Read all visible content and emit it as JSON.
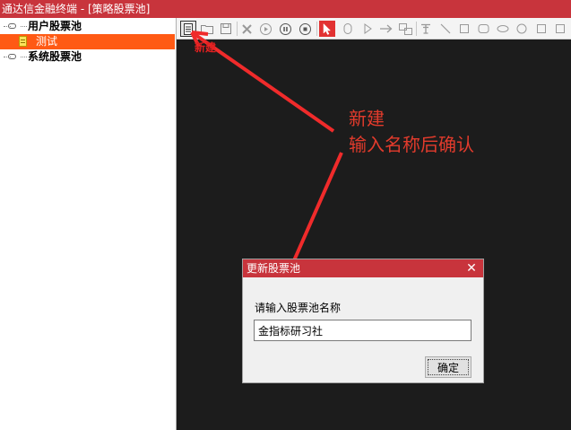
{
  "window": {
    "title": "通达信金融终端 - [策略股票池]"
  },
  "tree": {
    "items": [
      {
        "label": "用户股票池",
        "icon": "link-icon"
      },
      {
        "label": "测试",
        "icon": "document-icon",
        "selected": true
      },
      {
        "label": "系统股票池",
        "icon": "link-icon"
      }
    ]
  },
  "toolbar": {
    "buttons": [
      "new-icon",
      "open-icon",
      "save-icon",
      "delete-icon",
      "run-icon",
      "pause-icon",
      "stop-icon",
      "select-pointer-icon",
      "ellipse-icon",
      "play-outline-icon",
      "arrow-icon",
      "copy-icon",
      "text-icon",
      "line-icon",
      "rect-icon",
      "rounded-rect-icon",
      "oval-icon",
      "circle-icon"
    ]
  },
  "annotations": {
    "new_label": "新建",
    "big_line1": "新建",
    "big_line2": "输入名称后确认",
    "color": "#e23b2c"
  },
  "dialog": {
    "title": "更新股票池",
    "close_glyph": "✕",
    "prompt": "请输入股票池名称",
    "input_value": "金指标研习社",
    "ok_label": "确定"
  },
  "colors": {
    "titlebar": "#c8343c",
    "selection": "#ff5a14",
    "canvas": "#1c1c1c"
  }
}
